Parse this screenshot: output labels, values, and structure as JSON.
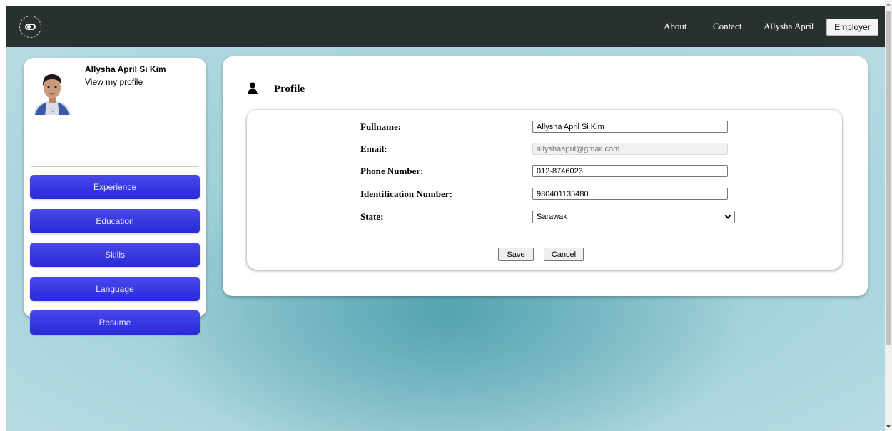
{
  "navbar": {
    "logo_icon": "toggle-logo-icon",
    "links": {
      "about": "About",
      "contact": "Contact",
      "user": "Allysha April"
    },
    "employer_label": "Employer"
  },
  "sidebar": {
    "user_name": "Allysha April Si Kim",
    "view_profile": "View my profile",
    "buttons": {
      "experience": "Experience",
      "education": "Education",
      "skills": "Skills",
      "language": "Language",
      "resume": "Resume"
    }
  },
  "profile": {
    "title": "Profile",
    "icon": "person-icon",
    "fields": {
      "fullname": {
        "label": "Fullname:",
        "value": "Allysha April Si Kim"
      },
      "email": {
        "label": "Email:",
        "value": "allyshaapril@gmail.com"
      },
      "phone": {
        "label": "Phone Number:",
        "value": "012-8746023"
      },
      "identification": {
        "label": "Identification Number:",
        "value": "980401135480"
      },
      "state": {
        "label": "State:",
        "value": "Sarawak"
      }
    },
    "save_label": "Save",
    "cancel_label": "Cancel"
  },
  "colors": {
    "navbar_bg": "#283030",
    "sidebar_button": "#3535e0",
    "background_teal": "#54a3b0"
  }
}
